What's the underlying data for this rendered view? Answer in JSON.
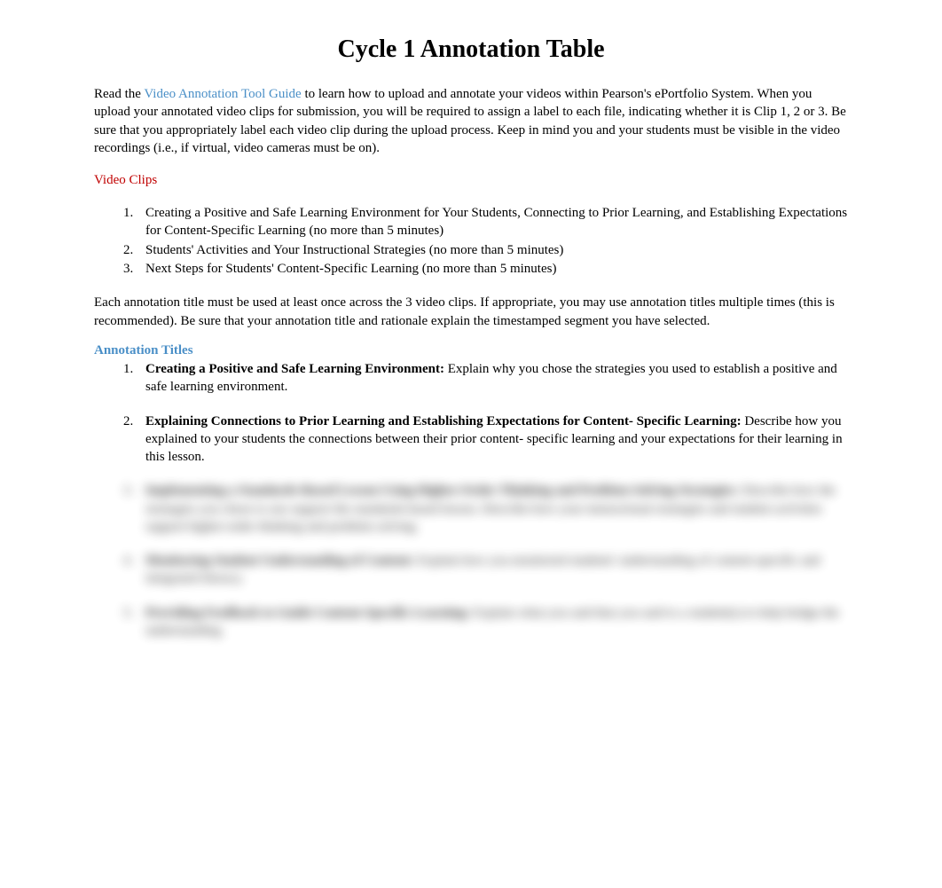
{
  "title": "Cycle 1 Annotation Table",
  "intro": {
    "prefix": "Read the ",
    "link_text": "Video Annotation Tool Guide",
    "suffix": " to learn how to upload and annotate your videos within Pearson's ePortfolio System. When you upload your annotated video clips for submission, you will be required to assign a label to each file, indicating whether it is Clip 1, 2 or 3. Be sure that you appropriately label each video clip during the upload process. Keep in mind you and your students must be visible in the video recordings (i.e., if virtual, video cameras must be on)."
  },
  "video_clips_header": "Video Clips",
  "video_clips": [
    "Creating a Positive and Safe Learning Environment for Your Students, Connecting to Prior Learning, and Establishing Expectations for Content-Specific Learning (no more than 5 minutes)",
    "Students' Activities and Your Instructional Strategies (no more than 5 minutes)",
    "Next Steps for Students' Content-Specific Learning (no more than 5 minutes)"
  ],
  "annotation_intro": "Each annotation title must be used at least once across the 3 video clips. If appropriate, you may use annotation titles multiple times (this is recommended). Be sure that your annotation title and rationale explain the timestamped segment you have selected.",
  "annotation_titles_header": "Annotation Titles",
  "annotations": [
    {
      "label": "Creating a Positive and Safe Learning Environment:",
      "text": " Explain why you chose the strategies you used to establish a positive and safe learning environment."
    },
    {
      "label": "Explaining Connections to Prior Learning and Establishing Expectations for Content- Specific Learning:",
      "text": " Describe how you explained to your students the connections between their prior content- specific learning and your expectations for their learning in this lesson."
    }
  ],
  "blurred": [
    {
      "label": "Implementing a Standards-Based Lesson Using Higher-Order Thinking and Problem-Solving Strategies:",
      "text": " Describe how the strategies you chose to use support the standards-based lesson. Describe how your instructional strategies and student activities support higher-order thinking and problem solving."
    },
    {
      "label": "Monitoring Student Understanding of Content:",
      "text": " Explain how you monitored students' understanding of content-specific and integrated literacy."
    },
    {
      "label": "Providing Feedback to Guide Content-Specific Learning:",
      "text": " Explain what you said that you said to a student(s) to help bridge the understanding."
    }
  ]
}
